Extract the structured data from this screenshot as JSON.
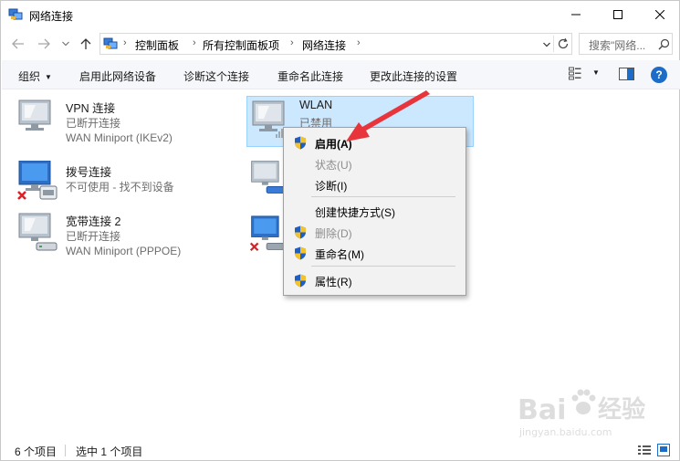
{
  "window": {
    "title": "网络连接"
  },
  "address": {
    "breadcrumbs": [
      "控制面板",
      "所有控制面板项",
      "网络连接"
    ]
  },
  "search": {
    "placeholder": "搜索\"网络..."
  },
  "commands": {
    "organize": "组织",
    "enable_device": "启用此网络设备",
    "diagnose": "诊断这个连接",
    "rename": "重命名此连接",
    "change_settings": "更改此连接的设置",
    "help": "?"
  },
  "items": [
    {
      "name": "VPN 连接",
      "status": "已断开连接",
      "device": "WAN Miniport (IKEv2)"
    },
    {
      "name": "WLAN",
      "status": "已禁用",
      "device": ""
    },
    {
      "name": "拨号连接",
      "status": "不可使用 - 找不到设备",
      "device": ""
    },
    {
      "name": "宽带连接 2",
      "status": "已断开连接",
      "device": "WAN Miniport (PPPOE)"
    }
  ],
  "context_menu": {
    "items": [
      {
        "label": "启用(A)",
        "bold": true,
        "disabled": false,
        "shield": true
      },
      {
        "label": "状态(U)",
        "bold": false,
        "disabled": true,
        "shield": false
      },
      {
        "label": "诊断(I)",
        "bold": false,
        "disabled": false,
        "shield": false
      },
      {
        "label": "创建快捷方式(S)",
        "bold": false,
        "disabled": false,
        "shield": false
      },
      {
        "label": "删除(D)",
        "bold": false,
        "disabled": true,
        "shield": true
      },
      {
        "label": "重命名(M)",
        "bold": false,
        "disabled": false,
        "shield": true
      },
      {
        "label": "属性(R)",
        "bold": false,
        "disabled": false,
        "shield": true
      }
    ]
  },
  "status_bar": {
    "count": "6 个项目",
    "selected": "选中 1 个项目"
  },
  "watermark": {
    "logo": "Baidu经验",
    "url": "jingyan.baidu.com"
  },
  "colors": {
    "accent_red": "#e8353b",
    "selection": "#cce8ff",
    "shield_blue": "#1f5fbf",
    "shield_yellow": "#f2c230"
  }
}
